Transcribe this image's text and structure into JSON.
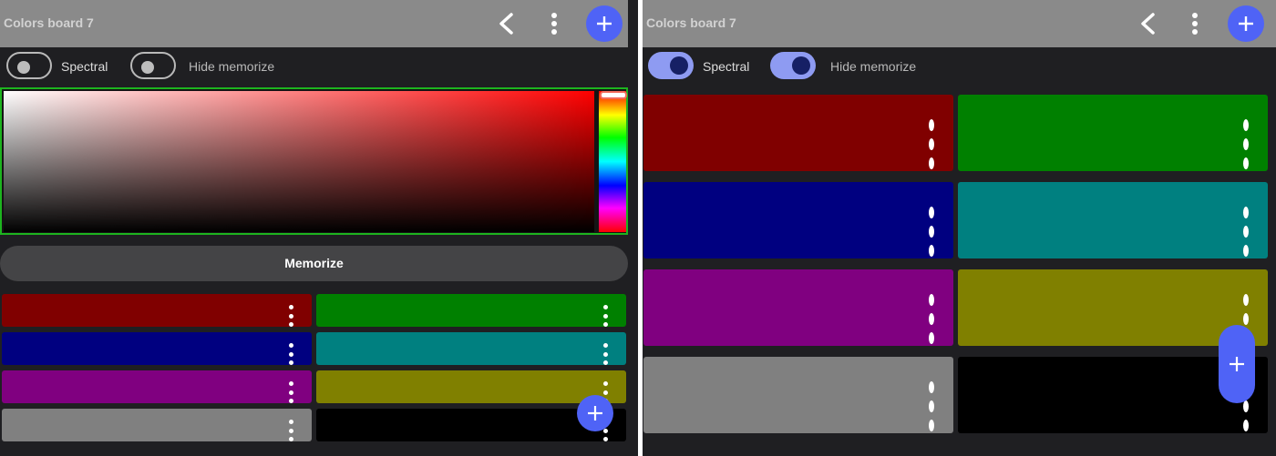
{
  "title": "Colors board 7",
  "toggles": {
    "spectral_label": "Spectral",
    "hide_memorize_label": "Hide memorize"
  },
  "memorize_label": "Memorize",
  "states": {
    "left": {
      "spectral": false,
      "hide_memorize": false
    },
    "right": {
      "spectral": true,
      "hide_memorize": true
    }
  },
  "picker": {
    "base_hue_color": "#ff0000",
    "border_color": "#1db41f"
  },
  "swatches": [
    "#800000",
    "#008000",
    "#000080",
    "#008080",
    "#800080",
    "#808000",
    "#808080",
    "#000000"
  ],
  "accent": "#4f63f6",
  "icons": {
    "back": "chevron-left-icon",
    "more": "more-vert-icon",
    "add": "plus-icon"
  }
}
